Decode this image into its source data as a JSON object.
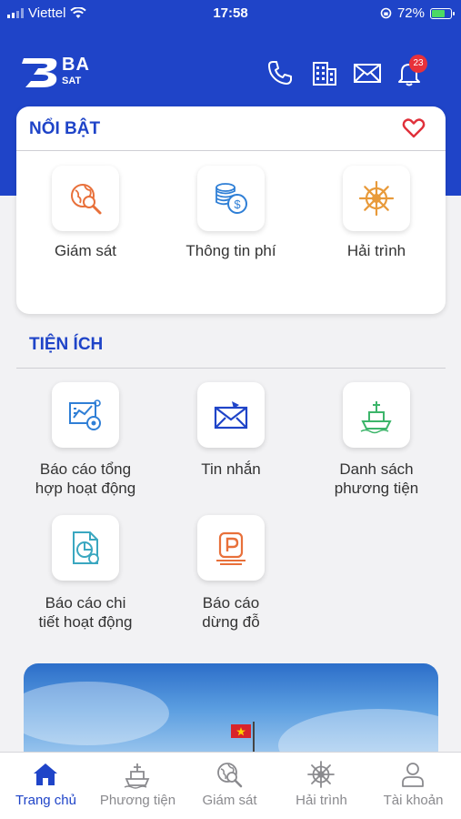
{
  "status_bar": {
    "carrier": "Viettel",
    "time": "17:58",
    "battery_percent": "72%",
    "battery_level": 0.72
  },
  "header": {
    "logo_top": "BA",
    "logo_bottom": "SAT",
    "notification_count": "23",
    "icons": [
      "phone-icon",
      "building-icon",
      "mail-icon",
      "bell-icon"
    ]
  },
  "highlight": {
    "title": "NỔI BẬT",
    "items": [
      {
        "label": "Giám sát",
        "icon": "globe-search-icon"
      },
      {
        "label": "Thông tin phí",
        "icon": "coins-icon"
      },
      {
        "label": "Hải trình",
        "icon": "ship-wheel-icon"
      }
    ]
  },
  "utilities": {
    "title": "TIỆN ÍCH",
    "items": [
      {
        "label_line1": "Báo cáo tổng",
        "label_line2": "hợp hoạt động",
        "icon": "report-chart-icon"
      },
      {
        "label_line1": "Tin nhắn",
        "label_line2": "",
        "icon": "message-envelope-icon"
      },
      {
        "label_line1": "Danh sách",
        "label_line2": "phương tiện",
        "icon": "vessel-list-icon"
      },
      {
        "label_line1": "Báo cáo chi",
        "label_line2": "tiết hoạt động",
        "icon": "detail-report-icon"
      },
      {
        "label_line1": "Báo cáo",
        "label_line2": "dừng đỗ",
        "icon": "parking-icon"
      }
    ]
  },
  "tabbar": {
    "tabs": [
      {
        "label": "Trang chủ",
        "icon": "home-icon",
        "active": true
      },
      {
        "label": "Phương tiện",
        "icon": "ship-icon",
        "active": false
      },
      {
        "label": "Giám sát",
        "icon": "globe-search-icon",
        "active": false
      },
      {
        "label": "Hải trình",
        "icon": "ship-wheel-icon",
        "active": false
      },
      {
        "label": "Tài khoản",
        "icon": "user-icon",
        "active": false
      }
    ]
  },
  "colors": {
    "brand_blue": "#1f44c8",
    "badge_red": "#e8313a",
    "icon_orange": "#e8703a",
    "icon_blue": "#2f7fd6",
    "icon_teal": "#3aa7c0",
    "icon_green": "#3cb56a",
    "heart_red": "#e0303a"
  }
}
